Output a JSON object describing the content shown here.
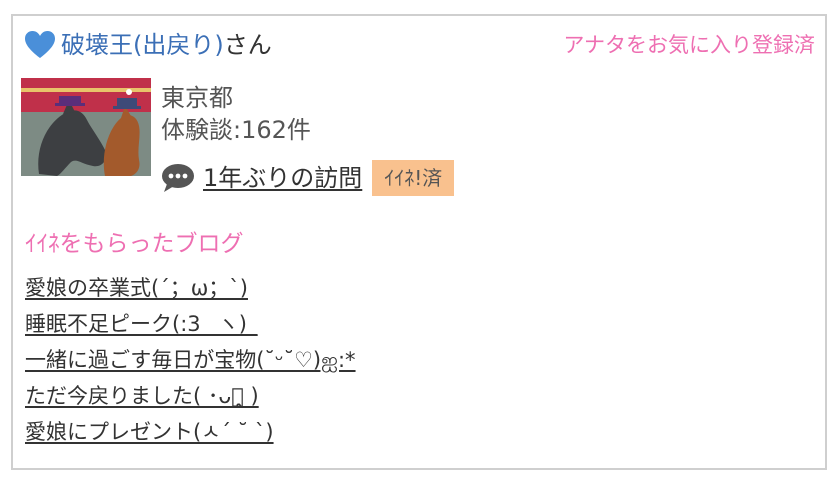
{
  "profile": {
    "user_name": "破壊王(出戻り)",
    "honorific": "さん",
    "favorite_status": "アナタをお気に入り登録済",
    "location": "東京都",
    "review_count": "体験談:162件",
    "latest_visit_title": "1年ぶりの訪問",
    "like_badge": "ｲｲﾈ!済",
    "icons": {
      "heart": "heart-icon",
      "speech": "speech-bubble-icon"
    },
    "colors": {
      "name_blue": "#3b6fb6",
      "accent_pink": "#ee6fb2",
      "badge_orange": "#f9c18e"
    }
  },
  "liked_blogs": {
    "title": "ｲｲﾈをもらったブログ",
    "items": [
      "愛娘の卒業式(´；ω；`)",
      "睡眠不足ピーク(:3 _ヽ)_",
      "一緒に過ごす毎日が宝物(˘ᵕ˘♡)ஐ:*",
      "ただ今戻りました( ･ᴗ･̥̥̥ )",
      "愛娘にプレゼント(ㅅ´ ˘ `)"
    ]
  }
}
